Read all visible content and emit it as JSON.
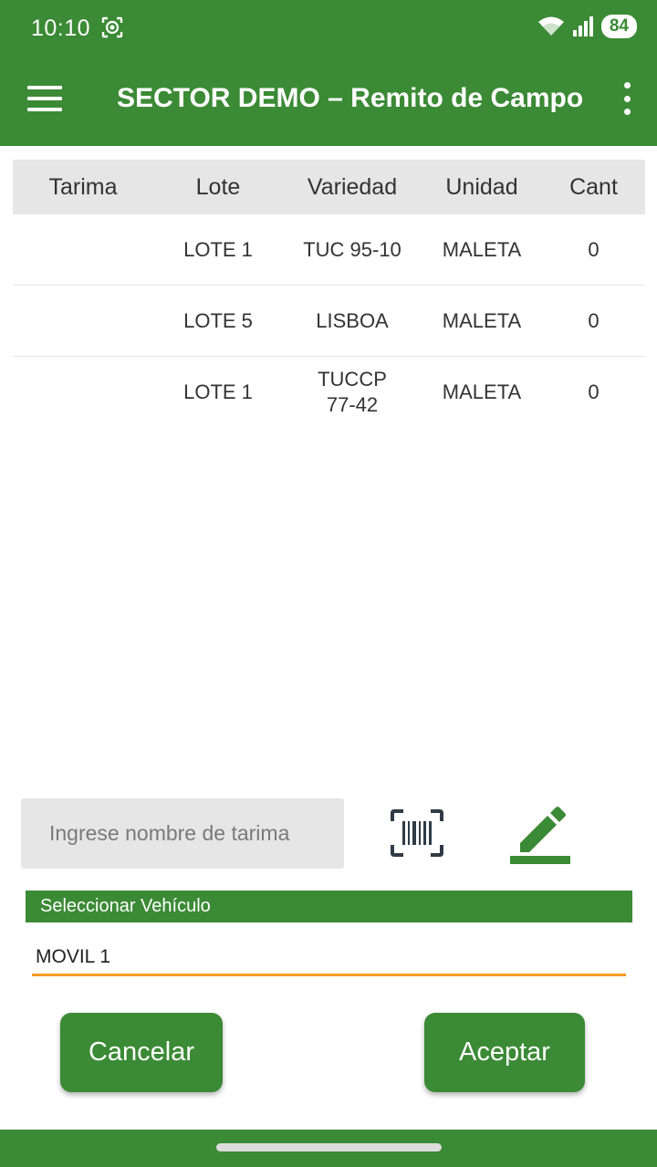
{
  "status": {
    "time": "10:10",
    "battery": "84",
    "icons": [
      "screen-record-icon",
      "wifi-icon",
      "signal-icon"
    ]
  },
  "app_bar": {
    "title": "SECTOR DEMO – Remito de Campo",
    "icons": [
      "menu-icon",
      "more-vert-icon"
    ]
  },
  "table": {
    "headers": [
      "Tarima",
      "Lote",
      "Variedad",
      "Unidad",
      "Cant"
    ],
    "rows": [
      {
        "tarima": "",
        "lote": "LOTE 1",
        "variedad": "TUC 95-10",
        "unidad": "MALETA",
        "cant": "0"
      },
      {
        "tarima": "",
        "lote": "LOTE 5",
        "variedad": "LISBOA",
        "unidad": "MALETA",
        "cant": "0"
      },
      {
        "tarima": "",
        "lote": "LOTE 1",
        "variedad": "TUCCP\n77-42",
        "unidad": "MALETA",
        "cant": "0"
      }
    ]
  },
  "tarima": {
    "placeholder": "Ingrese nombre de tarima",
    "value": ""
  },
  "vehicle": {
    "label": "Seleccionar Vehículo",
    "selected": "MOVIL 1"
  },
  "buttons": {
    "cancel": "Cancelar",
    "accept": "Aceptar"
  },
  "colors": {
    "primary": "#3b8a35",
    "accent_underline": "#f59a23",
    "header_bg": "#e6e6e6",
    "icon_dark": "#2f3b45"
  }
}
